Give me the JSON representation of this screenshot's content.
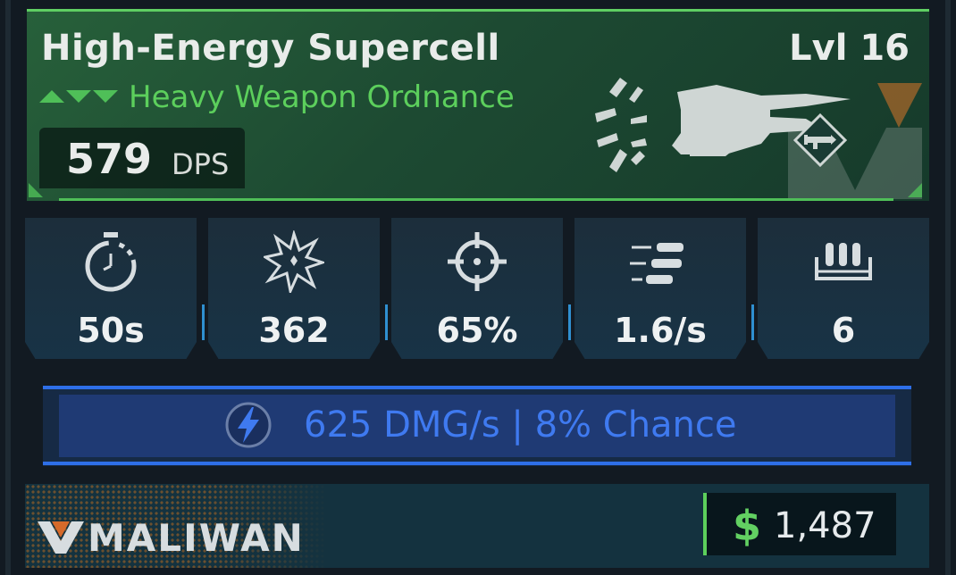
{
  "weapon": {
    "name": "High-Energy Supercell",
    "level": "Lvl 16",
    "type": "Heavy Weapon Ordnance",
    "dps_value": "579",
    "dps_label": "DPS",
    "rarity_color": "#5fcf63"
  },
  "stats": [
    {
      "icon": "stopwatch-icon",
      "value": "50s"
    },
    {
      "icon": "explosion-damage-icon",
      "value": "362"
    },
    {
      "icon": "crosshair-accuracy-icon",
      "value": "65%"
    },
    {
      "icon": "bullets-fire-rate-icon",
      "value": "1.6/s"
    },
    {
      "icon": "ammo-magazine-icon",
      "value": "6"
    }
  ],
  "elemental": {
    "icon": "shock-lightning-icon",
    "text": "625 DMG/s | 8% Chance",
    "color": "#3f7af0"
  },
  "footer": {
    "manufacturer": "MALIWAN",
    "price_icon": "$",
    "price": "1,487"
  }
}
